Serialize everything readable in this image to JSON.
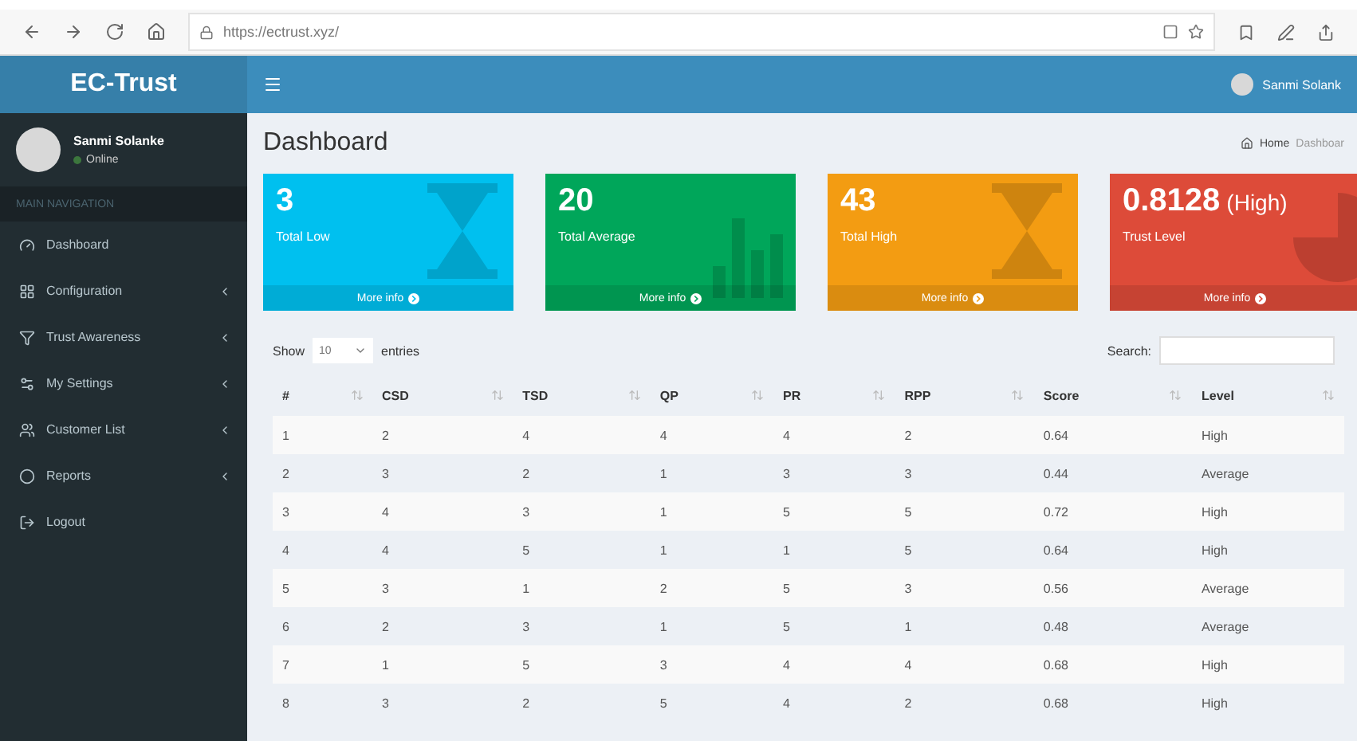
{
  "browser": {
    "url": "https://ectrust.xyz/"
  },
  "header": {
    "brand": "EC-Trust",
    "user": "Sanmi Solank"
  },
  "sidebar": {
    "user": {
      "name": "Sanmi Solanke",
      "status": "Online"
    },
    "section": "MAIN NAVIGATION",
    "items": [
      {
        "label": "Dashboard",
        "kind": "dashboard",
        "submenu": false
      },
      {
        "label": "Configuration",
        "kind": "grid",
        "submenu": true
      },
      {
        "label": "Trust Awareness",
        "kind": "trust",
        "submenu": true
      },
      {
        "label": "My Settings",
        "kind": "gears",
        "submenu": true
      },
      {
        "label": "Customer List",
        "kind": "users",
        "submenu": true
      },
      {
        "label": "Reports",
        "kind": "reports",
        "submenu": true
      },
      {
        "label": "Logout",
        "kind": "logout",
        "submenu": false
      }
    ]
  },
  "page": {
    "title": "Dashboard",
    "breadcrumb": [
      "Home",
      "Dashboar"
    ]
  },
  "cards": [
    {
      "value": "3",
      "label": "Total Low",
      "link": "More info",
      "color": "#00c0ef",
      "kind": "hourglass"
    },
    {
      "value": "20",
      "label": "Total Average",
      "link": "More info",
      "color": "#00a65a",
      "kind": "bars"
    },
    {
      "value": "43",
      "label": "Total High",
      "link": "More info",
      "color": "#f39c12",
      "kind": "hourglass"
    },
    {
      "value": "0.8128",
      "suffix": "(High)",
      "label": "Trust Level",
      "link": "More info",
      "color": "#dd4b39",
      "kind": "pie"
    }
  ],
  "table": {
    "show_label": "Show",
    "page_size": "10",
    "entries_label": "entries",
    "search_label": "Search:",
    "columns": [
      "#",
      "CSD",
      "TSD",
      "QP",
      "PR",
      "RPP",
      "Score",
      "Level"
    ],
    "rows": [
      [
        "1",
        "2",
        "4",
        "4",
        "4",
        "2",
        "0.64",
        "High"
      ],
      [
        "2",
        "3",
        "2",
        "1",
        "3",
        "3",
        "0.44",
        "Average"
      ],
      [
        "3",
        "4",
        "3",
        "1",
        "5",
        "5",
        "0.72",
        "High"
      ],
      [
        "4",
        "4",
        "5",
        "1",
        "1",
        "5",
        "0.64",
        "High"
      ],
      [
        "5",
        "3",
        "1",
        "2",
        "5",
        "3",
        "0.56",
        "Average"
      ],
      [
        "6",
        "2",
        "3",
        "1",
        "5",
        "1",
        "0.48",
        "Average"
      ],
      [
        "7",
        "1",
        "5",
        "3",
        "4",
        "4",
        "0.68",
        "High"
      ],
      [
        "8",
        "3",
        "2",
        "5",
        "4",
        "2",
        "0.68",
        "High"
      ]
    ]
  }
}
